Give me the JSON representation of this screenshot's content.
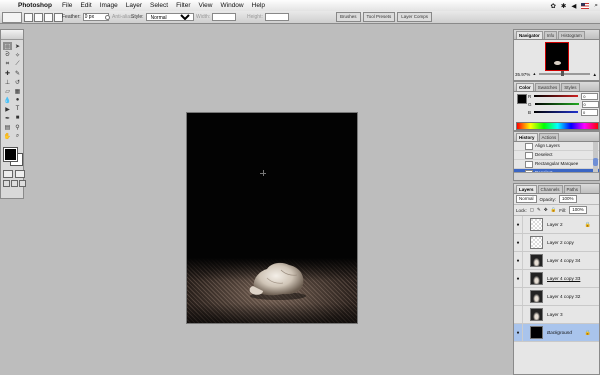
{
  "menubar": {
    "apple_icon": "apple-icon",
    "app_name": "Photoshop",
    "menus": [
      "File",
      "Edit",
      "Image",
      "Layer",
      "Select",
      "Filter",
      "View",
      "Window",
      "Help"
    ]
  },
  "options": {
    "feather_label": "Feather:",
    "feather_value": "0 px",
    "antialias_label": "Anti-alias",
    "style_label": "Style:",
    "style_value": "Normal",
    "width_label": "Width:",
    "height_label": "Height:",
    "well_tabs": [
      "Brushes",
      "Tool Presets",
      "Layer Comps"
    ]
  },
  "navigator": {
    "tabs": [
      "Navigator",
      "Info",
      "Histogram"
    ],
    "zoom": "35.97%"
  },
  "color": {
    "tabs": [
      "Color",
      "Swatches",
      "Styles"
    ],
    "rows": [
      {
        "label": "R",
        "value": "0",
        "color": "#cc2222"
      },
      {
        "label": "G",
        "value": "0",
        "color": "#22aa22"
      },
      {
        "label": "B",
        "value": "0",
        "color": "#2233cc"
      }
    ]
  },
  "history": {
    "tabs": [
      "History",
      "Actions"
    ],
    "items": [
      "Align Layers",
      "Deselect",
      "Rectangular Marquee",
      "Deselect"
    ],
    "selected_index": 3
  },
  "layers": {
    "tabs": [
      "Layers",
      "Channels",
      "Paths"
    ],
    "blend_mode": "Normal",
    "opacity_label": "Opacity:",
    "opacity_value": "100%",
    "lock_label": "Lock:",
    "fill_label": "Fill:",
    "fill_value": "100%",
    "items": [
      {
        "name": "Layer 2",
        "visible": true,
        "thumb": "checker",
        "locked": true
      },
      {
        "name": "Layer 2 copy",
        "visible": true,
        "thumb": "checker",
        "locked": false
      },
      {
        "name": "Layer 4 copy 34",
        "visible": true,
        "thumb": "cat",
        "locked": false
      },
      {
        "name": "Layer 4 copy 33",
        "visible": true,
        "thumb": "cat",
        "locked": false
      },
      {
        "name": "Layer 4 copy 32",
        "visible": false,
        "thumb": "cat",
        "locked": false
      },
      {
        "name": "Layer 3",
        "visible": false,
        "thumb": "cat",
        "locked": false
      },
      {
        "name": "Background",
        "visible": true,
        "thumb": "dark",
        "locked": true
      }
    ]
  }
}
